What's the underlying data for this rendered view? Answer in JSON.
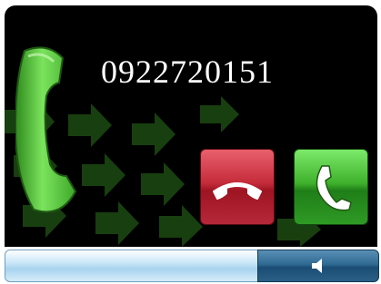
{
  "call": {
    "phone_number": "0922720151"
  },
  "buttons": {
    "reject_icon": "hang-up-icon",
    "accept_icon": "phone-icon",
    "speaker_icon": "speaker-icon"
  },
  "colors": {
    "reject": "#c52b3a",
    "accept": "#3fb12c",
    "slider": "#a9d3ee",
    "speaker": "#2f6a93"
  }
}
